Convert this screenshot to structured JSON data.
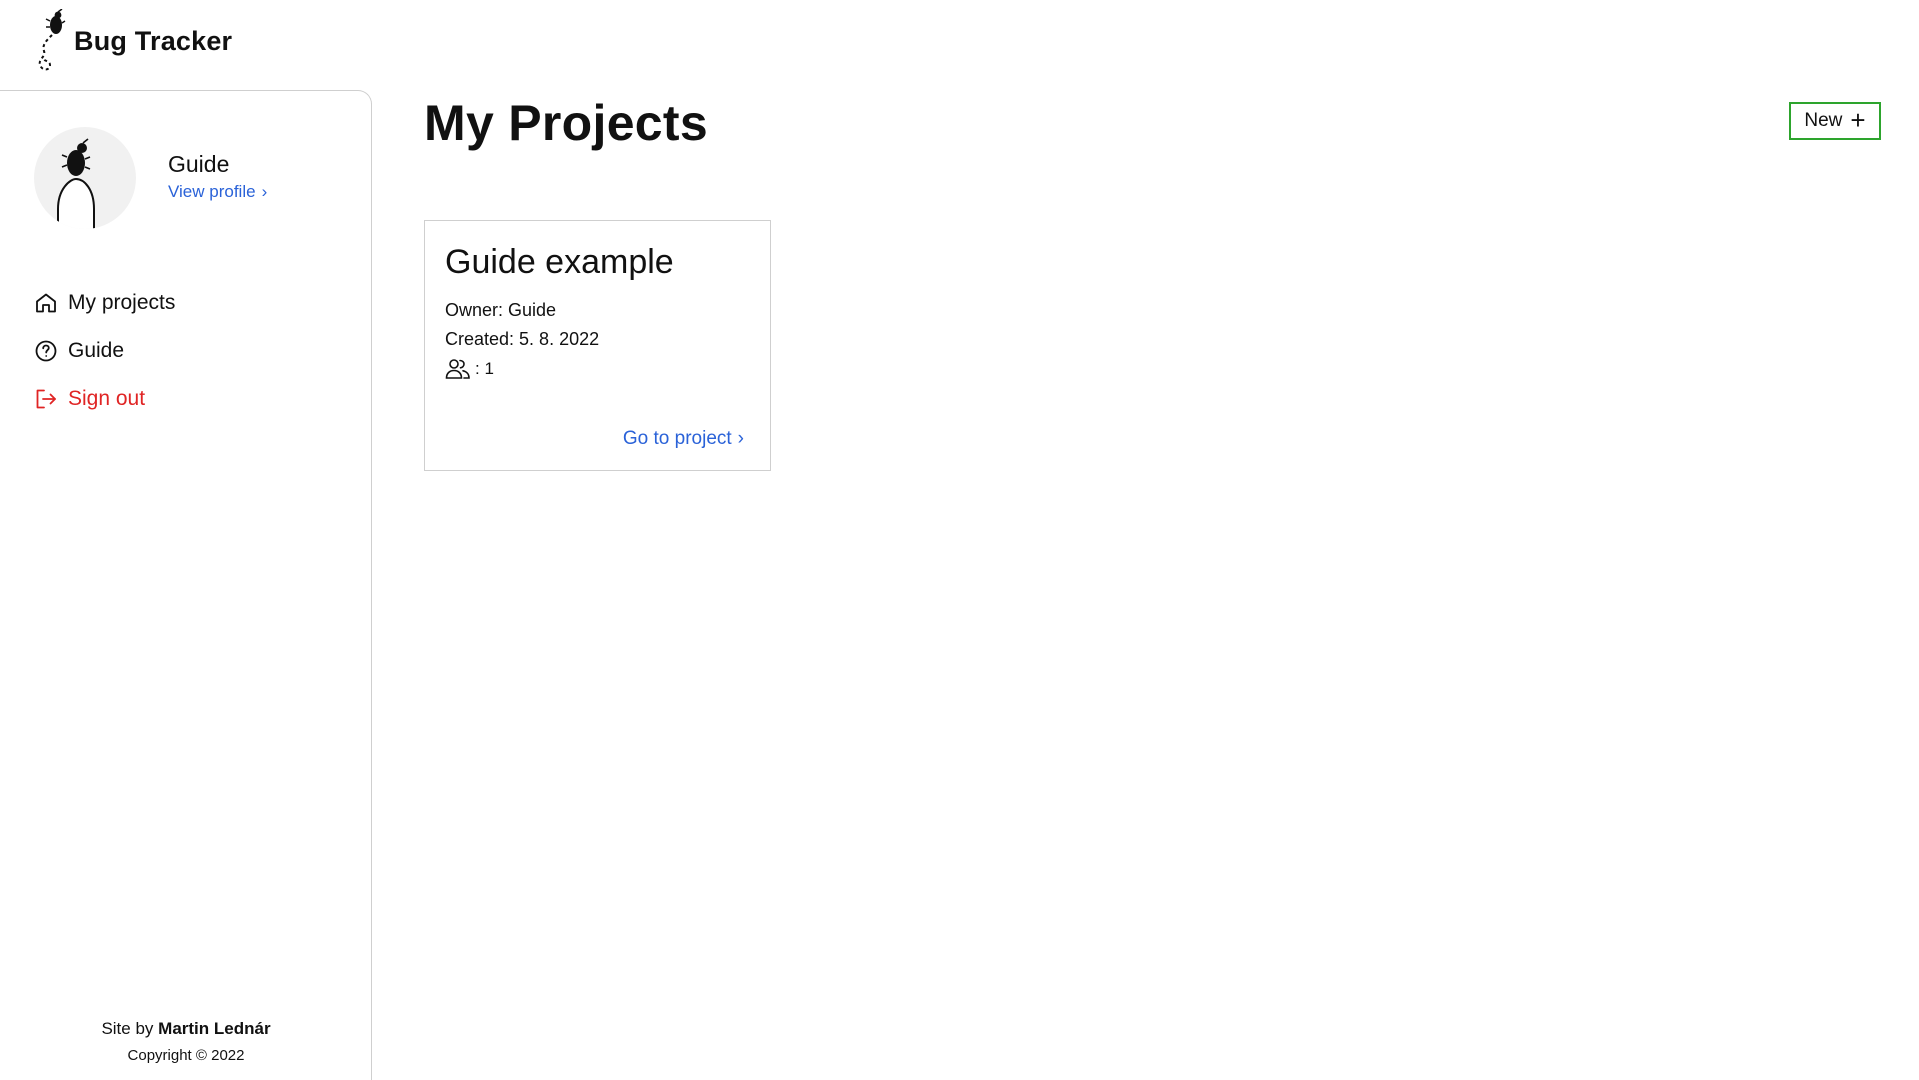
{
  "header": {
    "brand_title": "Bug Tracker",
    "logo_icon": "bug-logo-icon"
  },
  "sidebar": {
    "profile": {
      "name": "Guide",
      "link_label": "View profile",
      "avatar_icon": "bug-avatar-icon"
    },
    "items": [
      {
        "label": "My projects",
        "icon": "home-icon"
      },
      {
        "label": "Guide",
        "icon": "question-circle-icon"
      },
      {
        "label": "Sign out",
        "icon": "sign-out-icon",
        "color": "#e02424"
      }
    ],
    "footer": {
      "site_by": "Site by",
      "author": "Martin Lednár",
      "copyright": "Copyright © 2022"
    }
  },
  "main": {
    "title": "My Projects",
    "new_button_label": "New",
    "projects": [
      {
        "title": "Guide example",
        "owner": "Owner: Guide",
        "created": "Created: 5. 8. 2022",
        "members": ": 1",
        "link_label": "Go to project"
      }
    ]
  },
  "colors": {
    "accent_link": "#2a62d8",
    "new_button_border": "#2da42d",
    "sign_out": "#e02424"
  }
}
